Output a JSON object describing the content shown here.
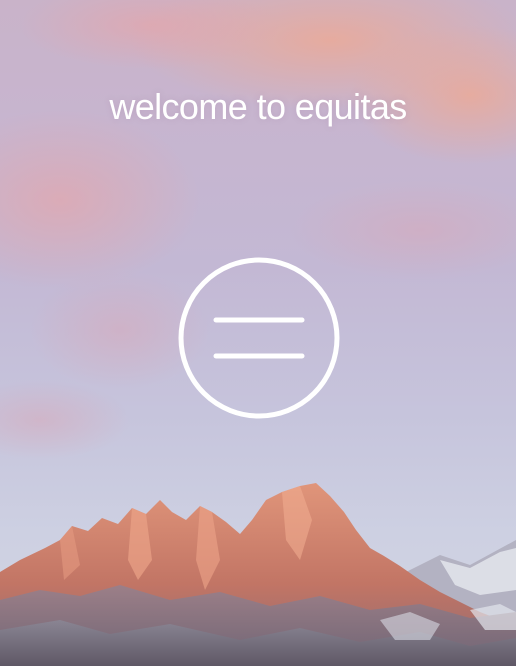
{
  "app": {
    "welcome_text": "welcome to equitas"
  },
  "logo": {
    "icon": "equals-circle-icon",
    "color": "#ffffff"
  },
  "background": {
    "scene": "mountain-sunset",
    "sky_colors": [
      "#c9b3c9",
      "#c3b8d4",
      "#d3d6e4"
    ],
    "peak_color": "#d6826a"
  }
}
